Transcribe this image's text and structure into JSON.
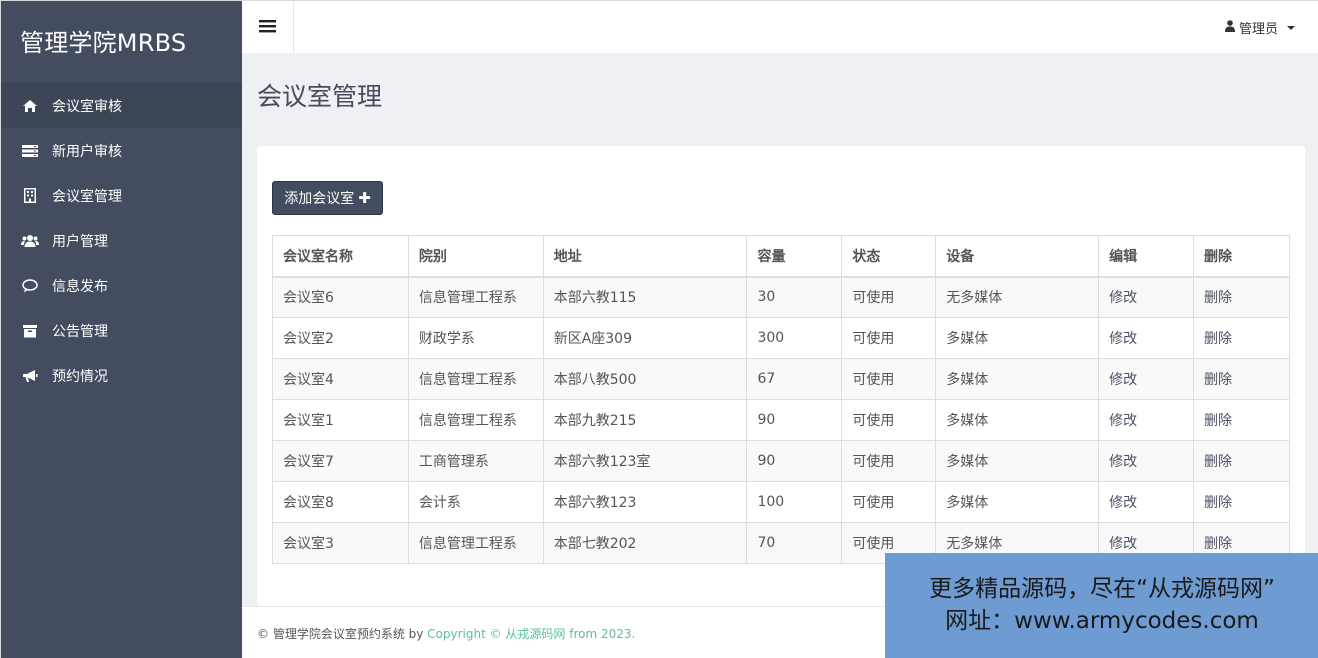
{
  "sidebar": {
    "brand": "管理学院MRBS",
    "items": [
      {
        "label": "会议室审核",
        "icon": "home-icon"
      },
      {
        "label": "新用户审核",
        "icon": "server-icon"
      },
      {
        "label": "会议室管理",
        "icon": "building-icon"
      },
      {
        "label": "用户管理",
        "icon": "users-icon"
      },
      {
        "label": "信息发布",
        "icon": "comment-icon"
      },
      {
        "label": "公告管理",
        "icon": "archive-icon"
      },
      {
        "label": "预约情况",
        "icon": "bullhorn-icon"
      }
    ]
  },
  "topbar": {
    "user_label": "管理员"
  },
  "main": {
    "title": "会议室管理",
    "add_button_label": "添加会议室",
    "table": {
      "columns": [
        "会议室名称",
        "院别",
        "地址",
        "容量",
        "状态",
        "设备",
        "编辑",
        "删除"
      ],
      "rows": [
        [
          "会议室6",
          "信息管理工程系",
          "本部六教115",
          "30",
          "可使用",
          "无多媒体",
          "修改",
          "删除"
        ],
        [
          "会议室2",
          "财政学系",
          "新区A座309",
          "300",
          "可使用",
          "多媒体",
          "修改",
          "删除"
        ],
        [
          "会议室4",
          "信息管理工程系",
          "本部八教500",
          "67",
          "可使用",
          "多媒体",
          "修改",
          "删除"
        ],
        [
          "会议室1",
          "信息管理工程系",
          "本部九教215",
          "90",
          "可使用",
          "多媒体",
          "修改",
          "删除"
        ],
        [
          "会议室7",
          "工商管理系",
          "本部六教123室",
          "90",
          "可使用",
          "多媒体",
          "修改",
          "删除"
        ],
        [
          "会议室8",
          "会计系",
          "本部六教123",
          "100",
          "可使用",
          "多媒体",
          "修改",
          "删除"
        ],
        [
          "会议室3",
          "信息管理工程系",
          "本部七教202",
          "70",
          "可使用",
          "无多媒体",
          "修改",
          "删除"
        ]
      ]
    }
  },
  "footer": {
    "prefix": "© 管理学院会议室预约系统 by ",
    "link": "Copyright © 从戎源码网 from 2023."
  },
  "watermark": {
    "line1": "更多精品源码，尽在“从戎源码网”",
    "line2": "网址：www.armycodes.com"
  }
}
